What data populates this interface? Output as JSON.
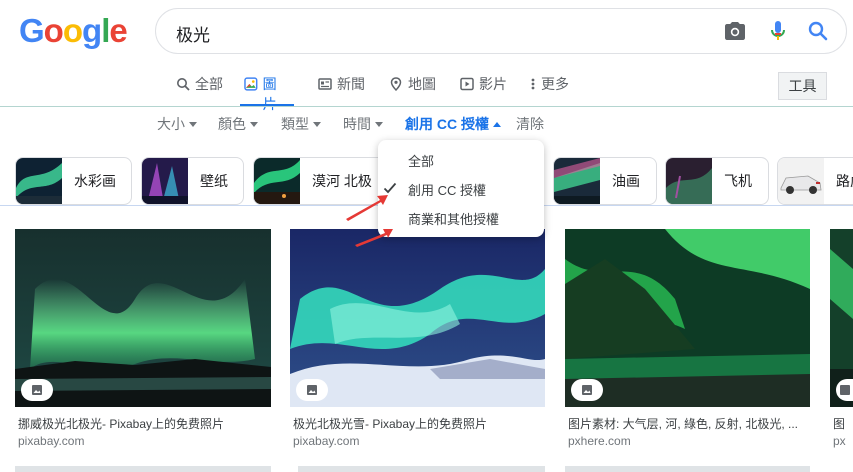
{
  "logo": {
    "letters": [
      "G",
      "o",
      "o",
      "g",
      "l",
      "e"
    ],
    "colors": [
      "#4285f4",
      "#ea4335",
      "#fbbc05",
      "#4285f4",
      "#34a853",
      "#ea4335"
    ]
  },
  "search": {
    "query": "极光"
  },
  "tabs": [
    {
      "label": "全部",
      "icon": "search-icon"
    },
    {
      "label": "圖片",
      "icon": "image-icon"
    },
    {
      "label": "新聞",
      "icon": "news-icon"
    },
    {
      "label": "地圖",
      "icon": "map-pin-icon"
    },
    {
      "label": "影片",
      "icon": "video-icon"
    },
    {
      "label": "更多",
      "icon": "more-vert-icon"
    }
  ],
  "tools_label": "工具",
  "filters": [
    "大小",
    "顏色",
    "類型",
    "時間",
    "創用 CC 授權",
    "清除"
  ],
  "license_menu": {
    "items": [
      "全部",
      "創用 CC 授權",
      "商業和其他授權"
    ],
    "selected_index": 1
  },
  "chips": [
    "水彩画",
    "壁纸",
    "漠河 北极",
    "油画",
    "飞机",
    "路虎"
  ],
  "results": [
    {
      "title": "挪威极光北极光- Pixabay上的免费照片",
      "site": "pixabay.com"
    },
    {
      "title": "极光北极光雪- Pixabay上的免费照片",
      "site": "pixabay.com"
    },
    {
      "title": "图片素材: 大气层, 河, 綠色, 反射, 北极光, ...",
      "site": "pxhere.com"
    },
    {
      "title": "图",
      "site": "px"
    }
  ],
  "colors": {
    "accent": "#1a73e8",
    "arrow": "#e53935"
  }
}
